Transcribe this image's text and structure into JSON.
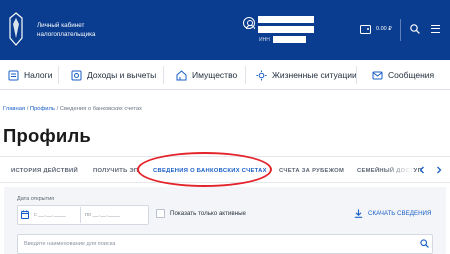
{
  "header": {
    "cabinet_line1": "Личный кабинет",
    "cabinet_line2": "налогоплательщика",
    "inn_label": "ИНН",
    "balance": "0.00 ₽",
    "brand_color": "#0a3d8f"
  },
  "icons": {
    "logo": "fns-logo-icon",
    "user": "user-icon",
    "wallet": "wallet-icon",
    "search": "search-icon",
    "menu": "menu-icon"
  },
  "nav": {
    "items": [
      {
        "label": "Налоги",
        "icon": "taxes-icon"
      },
      {
        "label": "Доходы и вычеты",
        "icon": "income-icon"
      },
      {
        "label": "Имущество",
        "icon": "property-icon"
      },
      {
        "label": "Жизненные ситуации",
        "icon": "life-situations-icon"
      },
      {
        "label": "Сообщения",
        "icon": "messages-icon"
      }
    ]
  },
  "breadcrumb": {
    "home": "Главная",
    "sep1": " / ",
    "profile": "Профиль",
    "sep2": " / ",
    "current": "Сведения о банковских счетах"
  },
  "page": {
    "title": "Профиль"
  },
  "tabs": [
    {
      "label": "ИСТОРИЯ ДЕЙСТВИЙ",
      "active": false
    },
    {
      "label": "ПОЛУЧИТЬ ЭП",
      "active": false
    },
    {
      "label": "СВЕДЕНИЯ О БАНКОВСКИХ СЧЕТАХ",
      "active": true
    },
    {
      "label": "СЧЕТА ЗА РУБЕЖОМ",
      "active": false
    },
    {
      "label": "СЕМЕЙНЫЙ ДОСТУП",
      "active": false
    }
  ],
  "filters": {
    "date_label": "Дата открытия",
    "date_from_placeholder": "с __.__.____",
    "date_to_placeholder": "по __.__.____",
    "only_active_label": "Показать только активные",
    "download_label": "СКАЧАТЬ СВЕДЕНИЯ",
    "search_placeholder": "Введите наименование для поиска"
  },
  "colors": {
    "accent": "#1a5fc7",
    "highlight": "#e3242b"
  }
}
